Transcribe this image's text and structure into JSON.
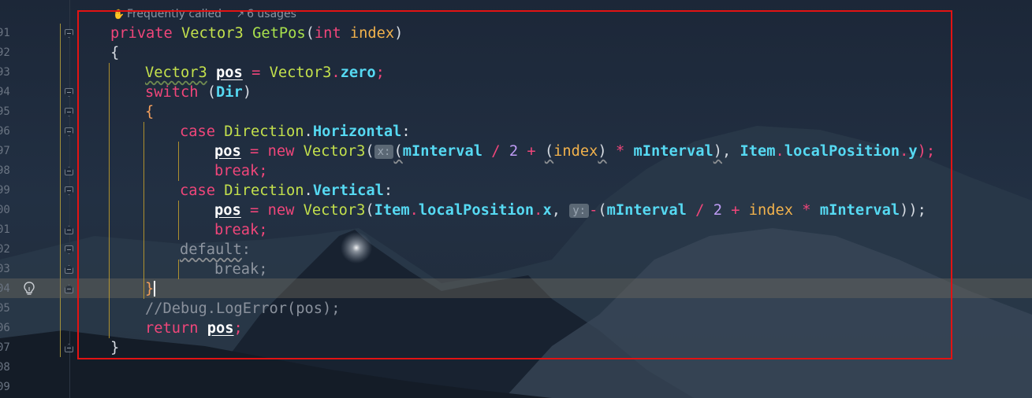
{
  "editor": {
    "usage_hints": {
      "frequently_called": "Frequently called",
      "usages": "6 usages"
    },
    "line_numbers": [
      "91",
      "92",
      "93",
      "94",
      "95",
      "96",
      "97",
      "98",
      "99",
      "00",
      "01",
      "02",
      "03",
      "04",
      "05",
      "06",
      "07",
      "08",
      "09"
    ],
    "code": {
      "l91": {
        "kw": "private",
        "type": "Vector3",
        "fn": "GetPos",
        "paren_open": "(",
        "param_type": "int",
        "param": "index",
        "paren_close": ")"
      },
      "l92": {
        "brace": "{"
      },
      "l93": {
        "type": "Vector3",
        "var": "pos",
        "eq": "=",
        "type2": "Vector3",
        "dot": ".",
        "field": "zero",
        "semi": ";"
      },
      "l94": {
        "kw": "switch",
        "open": "(",
        "var": "Dir",
        "close": ")"
      },
      "l95": {
        "brace": "{"
      },
      "l96": {
        "kw": "case",
        "type": "Direction",
        "dot": ".",
        "field": "Horizontal",
        "colon": ":"
      },
      "l97": {
        "var": "pos",
        "eq": "=",
        "kw": "new",
        "type": "Vector3",
        "open": "(",
        "hint": "x:",
        "p1": "(",
        "a": "mInterval",
        "div": "/",
        "two": "2",
        "plus": "+",
        "p2": "(",
        "idx": "index",
        "p3": ")",
        "mul": "*",
        "b": "mInterval",
        "p4": ")",
        "comma": ",",
        "item": "Item",
        "dot1": ".",
        "lp": "localPosition",
        "dot2": ".",
        "y": "y",
        "close": ");"
      },
      "l98": {
        "kw": "break",
        "semi": ";"
      },
      "l99": {
        "kw": "case",
        "type": "Direction",
        "dot": ".",
        "field": "Vertical",
        "colon": ":"
      },
      "l00": {
        "var": "pos",
        "eq": "=",
        "kw": "new",
        "type": "Vector3",
        "open": "(",
        "item": "Item",
        "dot1": ".",
        "lp": "localPosition",
        "dot2": ".",
        "x": "x",
        "comma": ",",
        "hint": "y:",
        "minus": "-",
        "p1": "(",
        "a": "mInterval",
        "div": "/",
        "two": "2",
        "plus": "+",
        "idx": "index",
        "mul": "*",
        "b": "mInterval",
        "close": "));"
      },
      "l01": {
        "kw": "break",
        "semi": ";"
      },
      "l02": {
        "kw": "default",
        "colon": ":"
      },
      "l03": {
        "kw": "break",
        "semi": ";"
      },
      "l04": {
        "brace": "}"
      },
      "l05": {
        "comment": "//Debug.LogError(pos);"
      },
      "l06": {
        "kw": "return",
        "var": "pos",
        "semi": ";"
      },
      "l07": {
        "brace": "}"
      }
    }
  },
  "colors": {
    "selection_frame": "#e21313",
    "keyword": "#f0467a",
    "type": "#c3e04c",
    "field": "#56d9f2",
    "identifier": "#f2b24c",
    "background": "#1a2433"
  },
  "icons": [
    "frequently-called-icon",
    "usages-icon",
    "lightbulb-icon",
    "fold-icon"
  ]
}
